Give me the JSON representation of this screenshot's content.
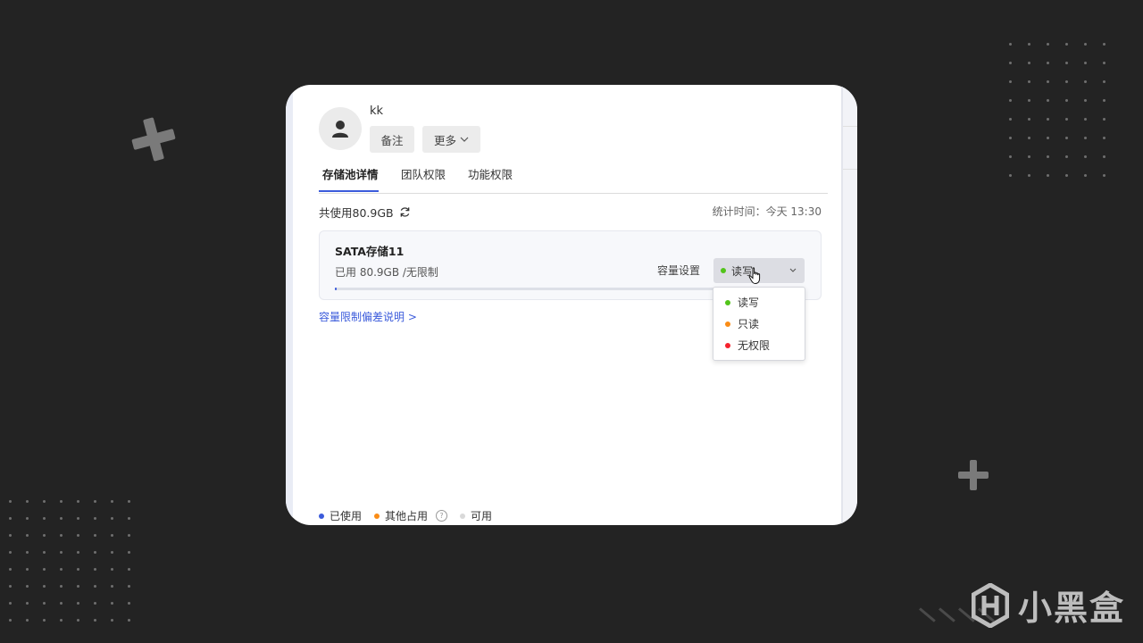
{
  "user": {
    "name": "kk"
  },
  "buttons": {
    "note": "备注",
    "more": "更多"
  },
  "tabs": [
    {
      "label": "存储池详情",
      "active": true
    },
    {
      "label": "团队权限",
      "active": false
    },
    {
      "label": "功能权限",
      "active": false
    }
  ],
  "summary": {
    "total_used": "共使用80.9GB",
    "stat_time": "统计时间：今天 13:30"
  },
  "pool": {
    "name": "SATA存储11",
    "used": "已用 80.9GB /无限制",
    "capacity_setting_label": "容量设置",
    "permission_selected": "读写",
    "usage_fraction": 0.005
  },
  "permission_options": [
    {
      "label": "读写",
      "color": "#52c41a"
    },
    {
      "label": "只读",
      "color": "#fa8c16"
    },
    {
      "label": "无权限",
      "color": "#f5222d"
    }
  ],
  "link": {
    "capacity_note": "容量限制偏差说明 >"
  },
  "legend": [
    {
      "label": "已使用",
      "color": "#3b5bdb"
    },
    {
      "label": "其他占用",
      "color": "#fa8c16",
      "help": "?"
    },
    {
      "label": "可用",
      "color": "#d9d9d9"
    }
  ],
  "colors": {
    "accent": "#3b5bdb",
    "background": "#232323"
  },
  "watermark": {
    "text": "小黑盒"
  }
}
